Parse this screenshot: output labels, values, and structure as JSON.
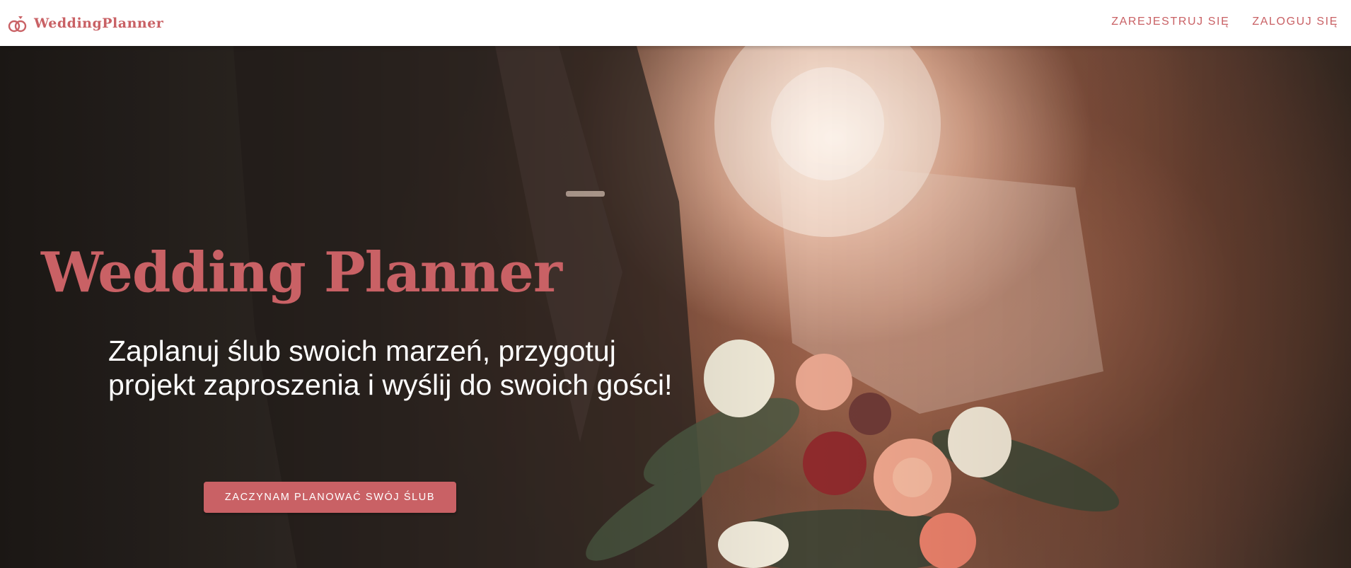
{
  "brand": {
    "name": "WeddingPlanner",
    "icon": "wedding-rings-icon",
    "color": "#c96165"
  },
  "nav": {
    "register_label": "ZAREJESTRUJ SIĘ",
    "login_label": "ZALOGUJ SIĘ"
  },
  "hero": {
    "title": "Wedding Planner",
    "subtitle_line1": "Zaplanuj ślub swoich marzeń, przygotuj",
    "subtitle_line2": "projekt zaproszenia i wyślij do swoich gości!",
    "cta_label": "ZACZYNAM PLANOWAĆ SWÓJ ŚLUB",
    "background": "wedding-couple-bouquet-photo"
  }
}
